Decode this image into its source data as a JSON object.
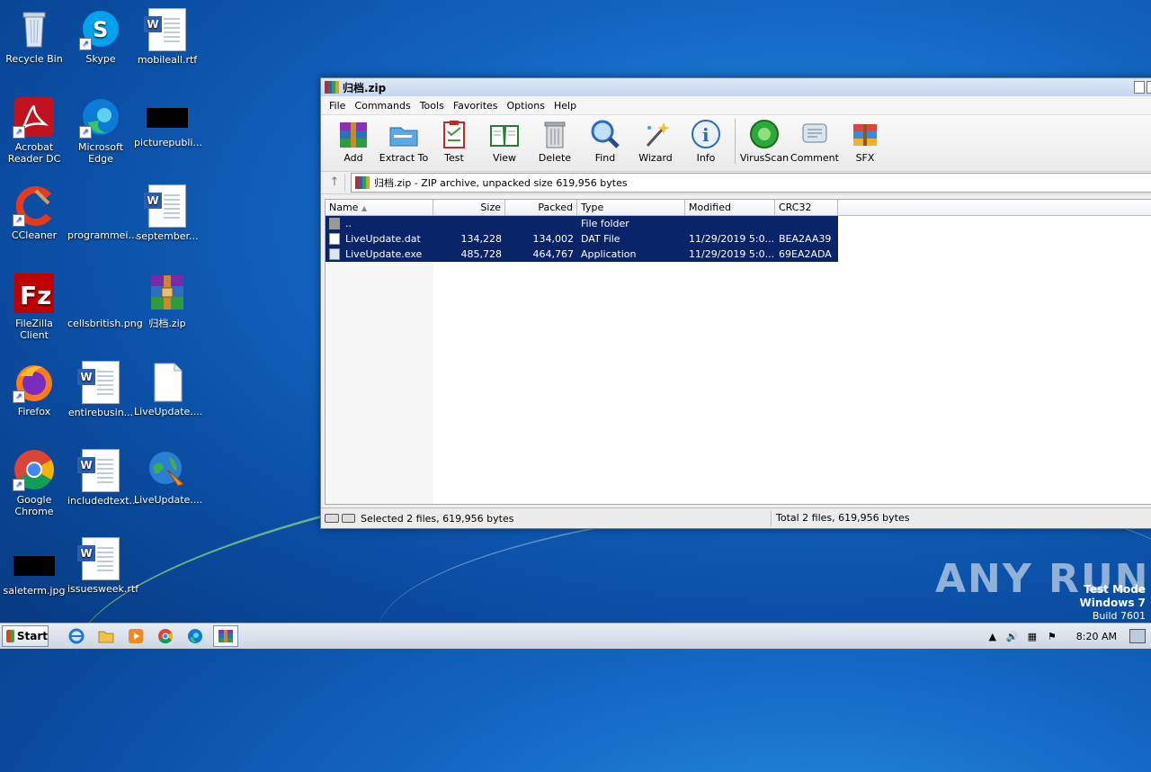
{
  "desktop": {
    "icons": [
      {
        "label": "Recycle Bin"
      },
      {
        "label": "Skype"
      },
      {
        "label": "mobileall.rtf"
      },
      {
        "label": "Acrobat Reader DC"
      },
      {
        "label": "Microsoft Edge"
      },
      {
        "label": "picturepubli..."
      },
      {
        "label": "CCleaner"
      },
      {
        "label": "programmei..."
      },
      {
        "label": "september..."
      },
      {
        "label": "FileZilla Client"
      },
      {
        "label": "cellsbritish.png"
      },
      {
        "label": "归档.zip"
      },
      {
        "label": "Firefox"
      },
      {
        "label": "entirebusin..."
      },
      {
        "label": "LiveUpdate...."
      },
      {
        "label": "Google Chrome"
      },
      {
        "label": "includedtext..."
      },
      {
        "label": "LiveUpdate...."
      },
      {
        "label": "saleterm.jpg"
      },
      {
        "label": "issuesweek.rtf"
      }
    ]
  },
  "window": {
    "title": "归档.zip",
    "menu": [
      "File",
      "Commands",
      "Tools",
      "Favorites",
      "Options",
      "Help"
    ],
    "toolbar": [
      {
        "label": "Add",
        "icon": "add-archive-icon"
      },
      {
        "label": "Extract To",
        "icon": "extract-folder-icon"
      },
      {
        "label": "Test",
        "icon": "test-clipboard-icon"
      },
      {
        "label": "View",
        "icon": "view-book-icon"
      },
      {
        "label": "Delete",
        "icon": "trash-icon"
      },
      {
        "label": "Find",
        "icon": "magnifier-icon"
      },
      {
        "label": "Wizard",
        "icon": "wand-icon"
      },
      {
        "label": "Info",
        "icon": "info-icon"
      },
      {
        "label": "VirusScan",
        "icon": "virus-scan-icon"
      },
      {
        "label": "Comment",
        "icon": "comment-icon"
      },
      {
        "label": "SFX",
        "icon": "sfx-icon"
      }
    ],
    "address": "归档.zip - ZIP archive, unpacked size 619,956 bytes",
    "columns": [
      "Name",
      "Size",
      "Packed",
      "Type",
      "Modified",
      "CRC32"
    ],
    "sort_indicator": "▲",
    "rows": [
      {
        "name": "..",
        "size": "",
        "packed": "",
        "type": "File folder",
        "modified": "",
        "crc": ""
      },
      {
        "name": "LiveUpdate.dat",
        "size": "134,228",
        "packed": "134,002",
        "type": "DAT File",
        "modified": "11/29/2019 5:0...",
        "crc": "BEA2AA39"
      },
      {
        "name": "LiveUpdate.exe",
        "size": "485,728",
        "packed": "464,767",
        "type": "Application",
        "modified": "11/29/2019 5:0...",
        "crc": "69EA2ADA"
      }
    ],
    "status_left": "Selected 2 files, 619,956 bytes",
    "status_right": "Total 2 files, 619,956 bytes"
  },
  "taskbar": {
    "start_label": "Start",
    "clock": "8:20 AM"
  },
  "watermark": "ANY RUN",
  "test_mode": {
    "line1": "Test Mode",
    "line2": "Windows 7",
    "line3": "Build 7601"
  }
}
